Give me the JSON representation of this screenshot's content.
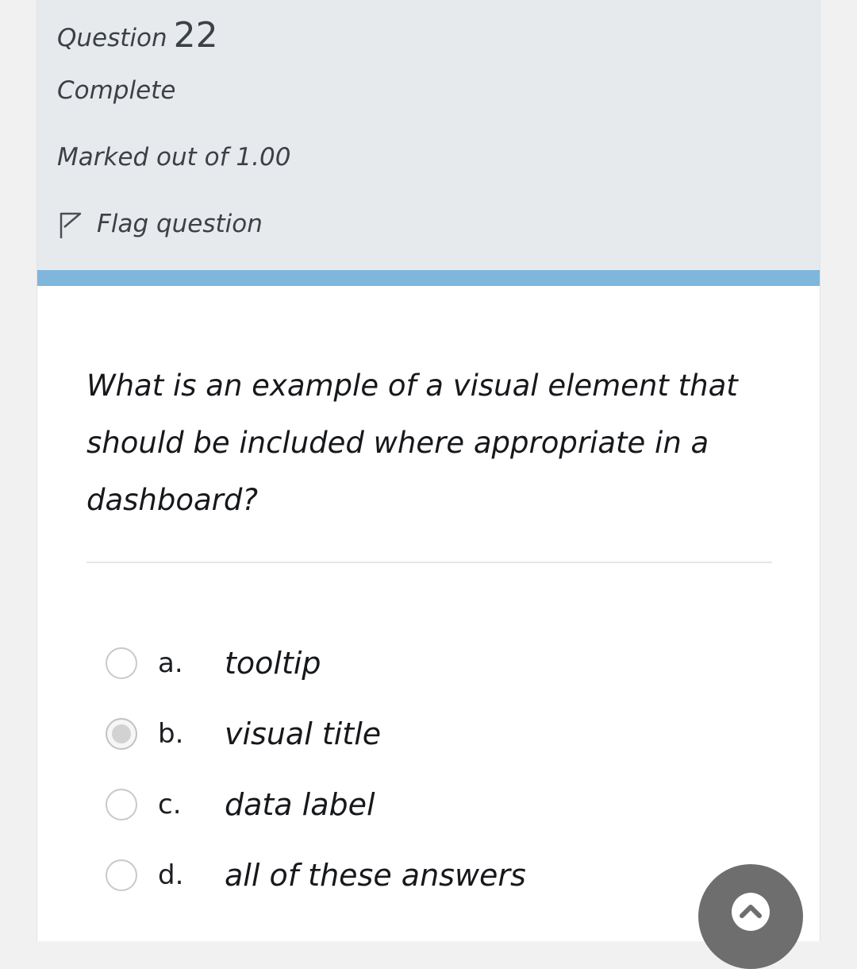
{
  "question_info": {
    "label": "Question",
    "number": "22",
    "state": "Complete",
    "grade": "Marked out of 1.00",
    "flag_label": "Flag question"
  },
  "question": {
    "text": "What is an example of a visual element that should be included where appropriate in a dashboard?"
  },
  "answers": [
    {
      "letter": "a.",
      "text": "tooltip",
      "selected": false
    },
    {
      "letter": "b.",
      "text": "visual title",
      "selected": true
    },
    {
      "letter": "c.",
      "text": "data label",
      "selected": false
    },
    {
      "letter": "d.",
      "text": "all of these answers",
      "selected": false
    }
  ],
  "icons": {
    "flag": "flag-outline-icon",
    "scroll_top": "chevron-up-icon"
  },
  "colors": {
    "info_panel_bg": "#e7eaed",
    "accent_bar": "#7fb6dc",
    "fab_bg": "#6e6e6e"
  }
}
